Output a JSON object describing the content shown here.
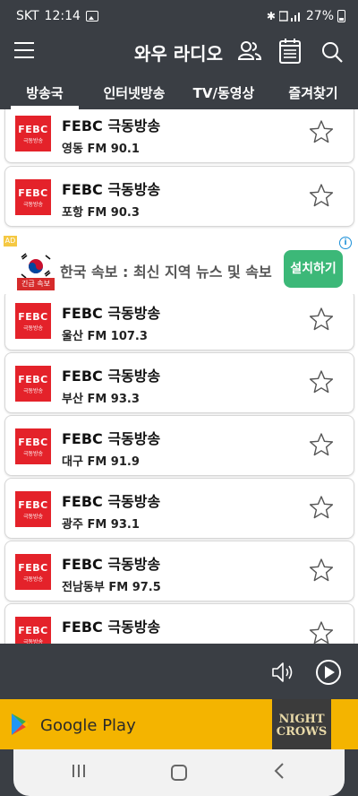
{
  "status": {
    "carrier": "SKT",
    "time": "12:14",
    "battery": "27%"
  },
  "app": {
    "title": "와우 라디오"
  },
  "tabs": [
    {
      "label": "방송국",
      "active": true
    },
    {
      "label": "인터넷방송",
      "active": false
    },
    {
      "label": "TV/동영상",
      "active": false
    },
    {
      "label": "즐겨찾기",
      "active": false
    }
  ],
  "logo": {
    "big": "FEBC",
    "small": "극동방송",
    "color": "#e4222a"
  },
  "stations": [
    {
      "name": "FEBC 극동방송",
      "freq": "영동 FM 90.1"
    },
    {
      "name": "FEBC 극동방송",
      "freq": "포항 FM 90.3"
    },
    {
      "name": "FEBC 극동방송",
      "freq": "울산 FM 107.3"
    },
    {
      "name": "FEBC 극동방송",
      "freq": "부산 FM 93.3"
    },
    {
      "name": "FEBC 극동방송",
      "freq": "대구 FM 91.9"
    },
    {
      "name": "FEBC 극동방송",
      "freq": "광주 FM 93.1"
    },
    {
      "name": "FEBC 극동방송",
      "freq": "전남동부 FM 97.5"
    },
    {
      "name": "FEBC 극동방송",
      "freq": ""
    }
  ],
  "ad": {
    "badge": "AD",
    "info": "i",
    "flag_label": "긴급 속보",
    "text": "한국 속보 : 최신 지역 뉴스 및 속보",
    "button": "설치하기",
    "button_color": "#3cb878"
  },
  "bottom_ad": {
    "text": "Google Play",
    "right_line1": "NIGHT",
    "right_line2": "CROWS",
    "bg": "#f4b400"
  },
  "icons": {
    "menu": "hamburger-icon",
    "account": "people-icon",
    "schedule": "calendar-icon",
    "search": "search-icon",
    "favorite": "star-outline-icon",
    "volume": "speaker-icon",
    "play": "play-circle-icon"
  }
}
